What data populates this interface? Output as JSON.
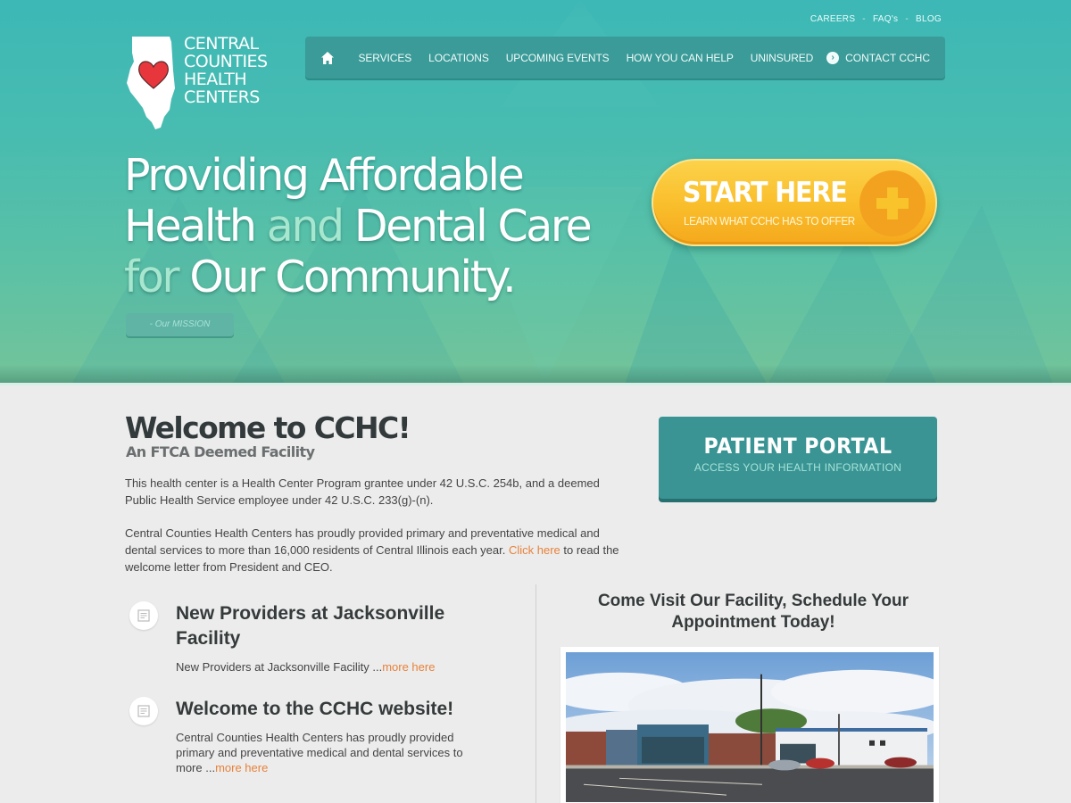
{
  "top_links": [
    {
      "label": "CAREERS"
    },
    {
      "label": "FAQ's"
    },
    {
      "label": "BLOG"
    }
  ],
  "top_links_separator": "-",
  "logo": {
    "lines": [
      "CENTRAL",
      "COUNTIES",
      "HEALTH",
      "CENTERS"
    ],
    "icon": "illinois-heart-icon"
  },
  "nav": {
    "home_icon": "home-icon",
    "items": [
      {
        "label": "SERVICES"
      },
      {
        "label": "LOCATIONS"
      },
      {
        "label": "UPCOMING EVENTS"
      },
      {
        "label": "HOW YOU CAN HELP"
      },
      {
        "label": "UNINSURED"
      }
    ],
    "contact": {
      "label": "CONTACT CCHC",
      "icon": "chevron-right-circle-icon"
    }
  },
  "hero": {
    "line1": "Providing Affordable",
    "line2_a": "Health",
    "line2_accent": "and",
    "line2_b": "Dental Care",
    "line3_accent": "for",
    "line3_b": "Our Community.",
    "mission_button": "- Our MISSION",
    "start_button": {
      "title": "START HERE",
      "subtitle": "LEARN WHAT CCHC HAS TO OFFER",
      "icon": "plus-icon"
    }
  },
  "welcome": {
    "title": "Welcome to CCHC!",
    "subtitle": "An FTCA Deemed Facility",
    "paragraph1": "This health center is a Health Center Program grantee under 42 U.S.C. 254b, and a deemed Public Health Service employee under 42 U.S.C. 233(g)-(n).",
    "paragraph2_before": "Central Counties Health Centers has proudly provided primary and preventative medical and dental services to more than 16,000 residents of Central Illinois each year. ",
    "paragraph2_link": "Click here",
    "paragraph2_after": " to read the welcome letter from President and CEO."
  },
  "portal": {
    "title": "PATIENT PORTAL",
    "subtitle": "ACCESS YOUR HEALTH INFORMATION"
  },
  "news": [
    {
      "icon": "document-icon",
      "title": "New Providers at Jacksonville Facility",
      "body": "New Providers at Jacksonville Facility ...",
      "link": "more here"
    },
    {
      "icon": "document-icon",
      "title": "Welcome to the CCHC website!",
      "body": "Central Counties Health Centers has proudly provided primary and preventative medical and dental services to more ...",
      "link": "more here"
    }
  ],
  "visit": {
    "title": "Come Visit Our Facility, Schedule Your Appointment Today!",
    "photo": "facility-photo"
  },
  "colors": {
    "brand_teal": "#3a9b98",
    "accent_orange": "#e8823a",
    "start_yellow": "#f9bd2a",
    "portal_teal": "#3a9494"
  }
}
